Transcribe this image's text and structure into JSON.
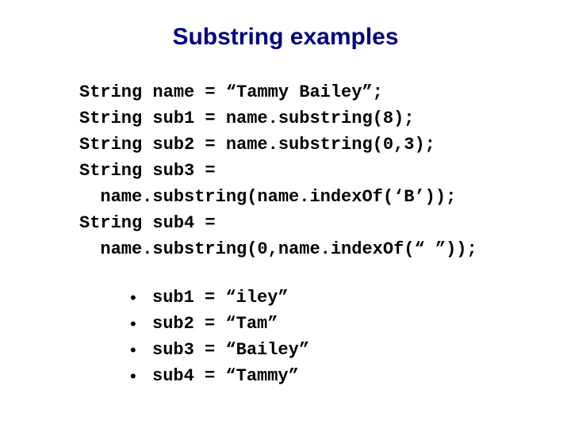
{
  "title": "Substring examples",
  "code": {
    "line1": "String name = “Tammy Bailey”;",
    "line2": "String sub1 = name.substring(8);",
    "line3": "String sub2 = name.substring(0,3);",
    "line4": "String sub3 =",
    "line5": "  name.substring(name.indexOf(‘B’));",
    "line6": "String sub4 =",
    "line7": "  name.substring(0,name.indexOf(“ ”));"
  },
  "results": [
    "sub1 = “iley”",
    "sub2 = “Tam”",
    "sub3 = “Bailey”",
    "sub4 = “Tammy”"
  ]
}
